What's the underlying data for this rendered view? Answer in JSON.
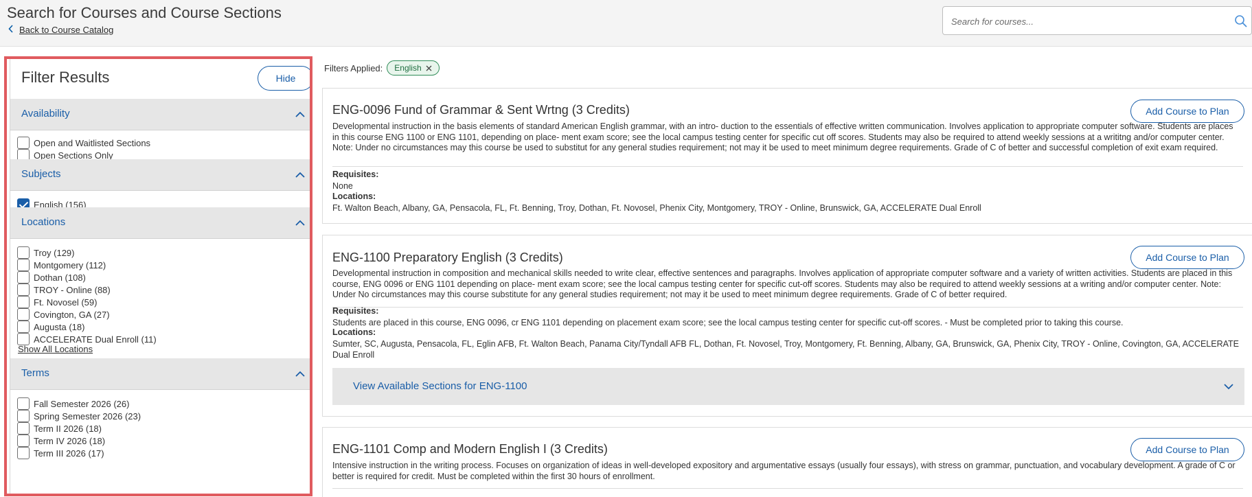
{
  "header": {
    "title": "Search for Courses and Course Sections",
    "back_link": "Back to Course Catalog",
    "search_placeholder": "Search for courses..."
  },
  "filter_panel": {
    "title": "Filter Results",
    "hide_label": "Hide",
    "sections": {
      "availability": {
        "label": "Availability",
        "options": [
          {
            "label": "Open and Waitlisted Sections",
            "checked": false
          },
          {
            "label": "Open Sections Only",
            "checked": false
          }
        ]
      },
      "subjects": {
        "label": "Subjects",
        "options": [
          {
            "label": "English (156)",
            "checked": true
          }
        ]
      },
      "locations": {
        "label": "Locations",
        "options": [
          {
            "label": "Troy (129)",
            "checked": false
          },
          {
            "label": "Montgomery (112)",
            "checked": false
          },
          {
            "label": "Dothan (108)",
            "checked": false
          },
          {
            "label": "TROY - Online (88)",
            "checked": false
          },
          {
            "label": "Ft. Novosel (59)",
            "checked": false
          },
          {
            "label": "Covington, GA (27)",
            "checked": false
          },
          {
            "label": "Augusta (18)",
            "checked": false
          },
          {
            "label": "ACCELERATE Dual Enroll (11)",
            "checked": false
          }
        ],
        "show_all": "Show All Locations"
      },
      "terms": {
        "label": "Terms",
        "options": [
          {
            "label": "Fall Semester 2026 (26)",
            "checked": false
          },
          {
            "label": "Spring Semester 2026 (23)",
            "checked": false
          },
          {
            "label": "Term II 2026 (18)",
            "checked": false
          },
          {
            "label": "Term IV 2026 (18)",
            "checked": false
          },
          {
            "label": "Term III 2026 (17)",
            "checked": false
          }
        ]
      }
    }
  },
  "main": {
    "filters_applied_label": "Filters Applied:",
    "chips": [
      {
        "label": "English"
      }
    ],
    "courses": [
      {
        "title": "ENG-0096 Fund of Grammar & Sent Wrtng (3 Credits)",
        "add_label": "Add Course to Plan",
        "description": "Developmental instruction in the basis elements of standard American English grammar, with an intro- duction to the essentials of effective written communication. Involves application to appropriate computer software. Students are places in this course ENG 1100 or ENG 1101, depending on place- ment exam score; see the local campus testing center for specific cut off scores. Students may also be required to attend weekly sessions at a writitng and/or computer center. Note: Under no circumstances may this course be used to substitut for any general studies requirement; not may it be used to meet minimum degree requirements. Grade of C of better and successful completion of exit exam required.",
        "requisites_label": "Requisites:",
        "requisites": "None",
        "locations_label": "Locations:",
        "locations": "Ft. Walton Beach, Albany, GA, Pensacola, FL, Ft. Benning, Troy, Dothan, Ft. Novosel, Phenix City, Montgomery, TROY - Online, Brunswick, GA, ACCELERATE Dual Enroll"
      },
      {
        "title": "ENG-1100 Preparatory English (3 Credits)",
        "add_label": "Add Course to Plan",
        "description": "Developmental instruction in composition and mechanical skills needed to write clear, effective sentences and paragraphs. Involves application of appropriate computer software and a variety of written activities. Students are placed in this course, ENG 0096 or ENG 1101 depending on place- ment exam score; see the local campus testing center for specific cut-off scores. Students may also be required to attend weekly sessions at a writing and/or computer center. Note: Under No circumstances may this course substitute for any general studies requirement; not may it be used to meet minimum degree requirements. Grade of C of better required.",
        "requisites_label": "Requisites:",
        "requisites": "Students are placed in this course, ENG 0096, cr ENG 1101 depending on placement exam score; see the local campus testing center for specific cut-off scores. - Must be completed prior to taking this course.",
        "locations_label": "Locations:",
        "locations": "Sumter, SC, Augusta, Pensacola, FL, Eglin AFB, Ft. Walton Beach, Panama City/Tyndall AFB FL, Dothan, Ft. Novosel, Troy, Montgomery, Ft. Benning, Albany, GA, Brunswick, GA, Phenix City, TROY - Online, Covington, GA, ACCELERATE Dual Enroll",
        "sections_label": "View Available Sections for ENG-1100"
      },
      {
        "title": "ENG-1101 Comp and Modern English I (3 Credits)",
        "add_label": "Add Course to Plan",
        "description": "Intensive instruction in the writing process. Focuses on organization of ideas in well-developed expository and argumentative essays (usually four essays), with stress on grammar, punctuation, and vocabulary development. A grade of C or better is required for credit. Must be completed within the first 30 hours of enrollment."
      }
    ]
  },
  "colors": {
    "accent": "#1a5ea8",
    "highlight_border": "#e05b5f",
    "section_bg": "#e6e6e6",
    "chip_border": "#2e8b57"
  },
  "icons": [
    "chevron-left-icon",
    "search-icon",
    "chevron-up-icon",
    "chevron-down-icon",
    "close-icon",
    "checkmark-icon"
  ]
}
